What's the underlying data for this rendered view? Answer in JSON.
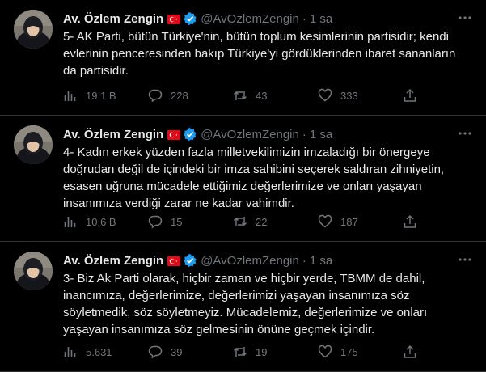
{
  "colors": {
    "background": "#000000",
    "text": "#e7e9ea",
    "secondary": "#71767b",
    "verified": "#1d9bf0",
    "flag_red": "#e30a17",
    "divider": "#2f3336"
  },
  "tweets": [
    {
      "author": "Av. Özlem Zengin",
      "handle": "@AvOzlemZengin",
      "separator": "·",
      "time": "1 sa",
      "text": "5- AK Parti, bütün Türkiye'nin, bütün toplum kesimlerinin partisidir; kendi evlerinin penceresinden bakıp Türkiye'yi gördüklerinden ibaret sananların da partisidir.",
      "views": "19,1 B",
      "replies": "228",
      "retweets": "43",
      "likes": "333"
    },
    {
      "author": "Av. Özlem Zengin",
      "handle": "@AvOzlemZengin",
      "separator": "·",
      "time": "1 sa",
      "text": "4- Kadın erkek yüzden fazla milletvekilimizin imzaladığı bir önergeye doğrudan değil de içindeki bir imza sahibini seçerek saldıran zihniyetin, esasen uğruna mücadele ettiğimiz değerlerimize ve onları yaşayan insanımıza verdiği zarar ne kadar vahimdir.",
      "views": "10,6 B",
      "replies": "15",
      "retweets": "22",
      "likes": "187"
    },
    {
      "author": "Av. Özlem Zengin",
      "handle": "@AvOzlemZengin",
      "separator": "·",
      "time": "1 sa",
      "text": "3- Biz Ak Parti olarak, hiçbir zaman ve hiçbir yerde, TBMM de dahil, inancımıza, değerlerimize, değerlerimizi yaşayan insanımıza söz söyletmedik, söz söyletmeyiz. Mücadelemiz, değerlerimize ve onları yaşayan insanımıza söz gelmesinin önüne geçmek içindir.",
      "views": "5.631",
      "replies": "39",
      "retweets": "19",
      "likes": "175"
    }
  ],
  "icons": [
    "avatar",
    "turkish-flag-icon",
    "verified-badge-icon",
    "more-icon",
    "views-icon",
    "reply-icon",
    "retweet-icon",
    "like-icon",
    "share-icon"
  ]
}
